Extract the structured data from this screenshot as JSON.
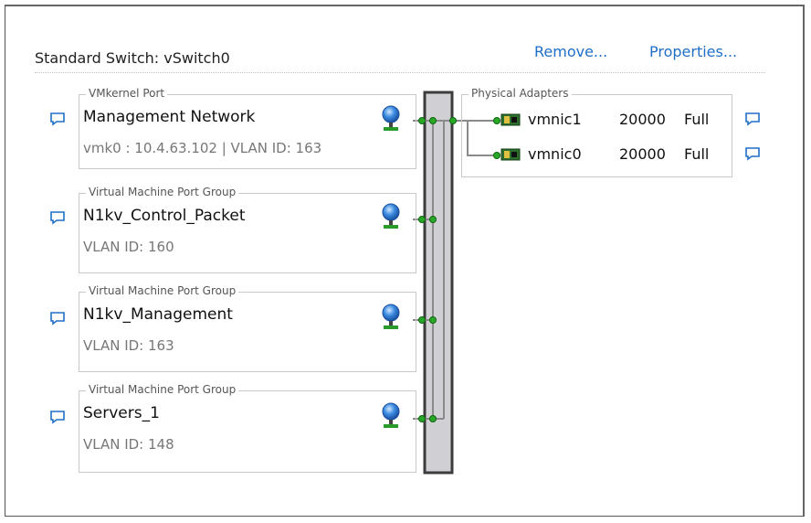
{
  "switch": {
    "title": "Standard Switch: vSwitch0",
    "remove_label": "Remove...",
    "properties_label": "Properties..."
  },
  "port_groups": [
    {
      "kind": "VMkernel Port",
      "name": "Management Network",
      "detail": "vmk0 : 10.4.63.102 | VLAN ID: 163"
    },
    {
      "kind": "Virtual Machine Port Group",
      "name": "N1kv_Control_Packet",
      "detail": "VLAN ID: 160"
    },
    {
      "kind": "Virtual Machine Port Group",
      "name": "N1kv_Management",
      "detail": "VLAN ID: 163"
    },
    {
      "kind": "Virtual Machine Port Group",
      "name": "Servers_1",
      "detail": "VLAN ID: 148"
    }
  ],
  "physical_adapters": {
    "label": "Physical Adapters",
    "items": [
      {
        "name": "vmnic1",
        "speed": "20000",
        "duplex": "Full"
      },
      {
        "name": "vmnic0",
        "speed": "20000",
        "duplex": "Full"
      }
    ]
  },
  "colors": {
    "link": "#1f6fc7",
    "connector": "#1a8f1a",
    "wire": "#808080",
    "switch_bar": "#cfcfd4"
  }
}
